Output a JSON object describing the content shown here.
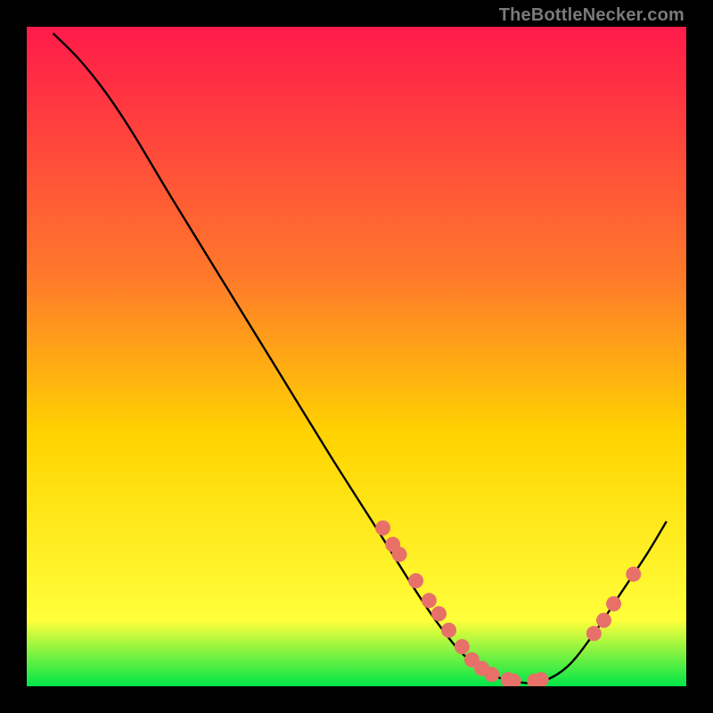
{
  "attribution": "TheBottleNecker.com",
  "colors": {
    "background": "#000000",
    "curve": "#000000",
    "dots": "#e77169",
    "gradient_top": "#ff1a4a",
    "gradient_mid1": "#ff7a2a",
    "gradient_mid2": "#ffd400",
    "gradient_mid3": "#ffff3a",
    "gradient_bottom": "#00e648"
  },
  "chart_data": {
    "type": "line",
    "title": "",
    "xlabel": "",
    "ylabel": "",
    "xlim": [
      0,
      100
    ],
    "ylim": [
      0,
      100
    ],
    "curve": [
      {
        "x": 4,
        "y": 99
      },
      {
        "x": 8,
        "y": 95
      },
      {
        "x": 12,
        "y": 90
      },
      {
        "x": 16,
        "y": 84
      },
      {
        "x": 22,
        "y": 74
      },
      {
        "x": 30,
        "y": 61
      },
      {
        "x": 38,
        "y": 48
      },
      {
        "x": 46,
        "y": 35
      },
      {
        "x": 53,
        "y": 24
      },
      {
        "x": 58,
        "y": 16
      },
      {
        "x": 62,
        "y": 10
      },
      {
        "x": 66,
        "y": 5
      },
      {
        "x": 70,
        "y": 2
      },
      {
        "x": 74,
        "y": 0.7
      },
      {
        "x": 78,
        "y": 0.7
      },
      {
        "x": 82,
        "y": 3
      },
      {
        "x": 86,
        "y": 8
      },
      {
        "x": 90,
        "y": 14
      },
      {
        "x": 94,
        "y": 20
      },
      {
        "x": 97,
        "y": 25
      }
    ],
    "dots": [
      {
        "x": 54,
        "y": 24
      },
      {
        "x": 55.5,
        "y": 21.5
      },
      {
        "x": 56.5,
        "y": 20
      },
      {
        "x": 59,
        "y": 16
      },
      {
        "x": 61,
        "y": 13
      },
      {
        "x": 62.5,
        "y": 11
      },
      {
        "x": 64,
        "y": 8.5
      },
      {
        "x": 66,
        "y": 6
      },
      {
        "x": 67.5,
        "y": 4
      },
      {
        "x": 69,
        "y": 2.7
      },
      {
        "x": 70.5,
        "y": 1.8
      },
      {
        "x": 73,
        "y": 1
      },
      {
        "x": 73.8,
        "y": 0.8
      },
      {
        "x": 77,
        "y": 0.8
      },
      {
        "x": 78,
        "y": 1
      },
      {
        "x": 86,
        "y": 8
      },
      {
        "x": 87.5,
        "y": 10
      },
      {
        "x": 89,
        "y": 12.5
      },
      {
        "x": 92,
        "y": 17
      }
    ]
  }
}
